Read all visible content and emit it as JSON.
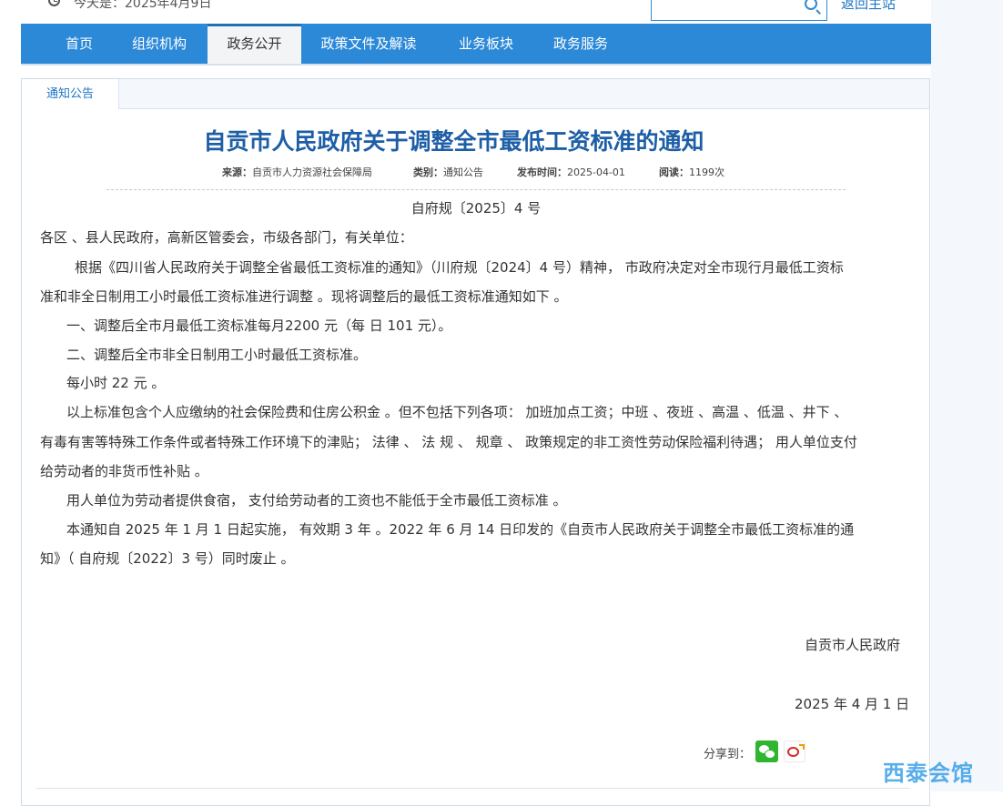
{
  "header": {
    "date_text": "今天是：2025年4月9日",
    "return_label": "返回主站",
    "search": {
      "placeholder": ""
    }
  },
  "nav": {
    "items": [
      "首页",
      "组织机构",
      "政务公开",
      "政策文件及解读",
      "业务板块",
      "政务服务"
    ],
    "active_index": 2
  },
  "tab": {
    "label": "通知公告"
  },
  "article": {
    "title": "自贡市人民政府关于调整全市最低工资标准的通知",
    "meta": {
      "source_label": "来源：",
      "source_value": "自贡市人力资源社会保障局",
      "category_label": "类别：",
      "category_value": "通知公告",
      "publish_label": "发布时间：",
      "publish_value": "2025-04-01",
      "views_label": "阅读：",
      "views_value": "1199次"
    },
    "doc_no": "自府规〔2025〕4 号",
    "salutation": "各区 、县人民政府，高新区管委会，市级各部门，有关单位：",
    "lines": [
      "根据《四川省人民政府关于调整全省最低工资标准的通知》（川府规〔2024〕4 号）精神， 市政府决定对全市现行月最低工资标",
      "准和非全日制用工小时最低工资标准进行调整 。现将调整后的最低工资标准通知如下 。",
      "一、调整后全市月最低工资标准每月2200 元（每 日 101 元）。",
      "二、调整后全市非全日制用工小时最低工资标准。",
      "每小时 22 元 。",
      "以上标准包含个人应缴纳的社会保险费和住房公积金 。但不包括下列各项： 加班加点工资；中班 、夜班 、高温 、低温 、井下 、",
      "有毒有害等特殊工作条件或者特殊工作环境下的津贴； 法律 、 法 规 、 规章 、 政策规定的非工资性劳动保险福利待遇； 用人单位支付",
      "给劳动者的非货币性补贴 。",
      "用人单位为劳动者提供食宿， 支付给劳动者的工资也不能低于全市最低工资标准 。",
      "本通知自 2025 年 1 月 1 日起实施， 有效期 3 年 。2022 年 6 月 14 日印发的《自贡市人民政府关于调整全市最低工资标准的通",
      "知》（ 自府规〔2022〕3 号）同时废止 。"
    ],
    "signature": "自贡市人民政府",
    "sign_date": "2025 年 4 月 1 日",
    "share_label": "分享到："
  },
  "watermark": "西泰会馆",
  "icons": [
    "clock-icon",
    "search-icon",
    "wechat-icon",
    "weibo-icon"
  ],
  "colors": {
    "nav_bg": "#2c89d8",
    "title": "#1d5ea6",
    "link": "#1f75c6"
  }
}
